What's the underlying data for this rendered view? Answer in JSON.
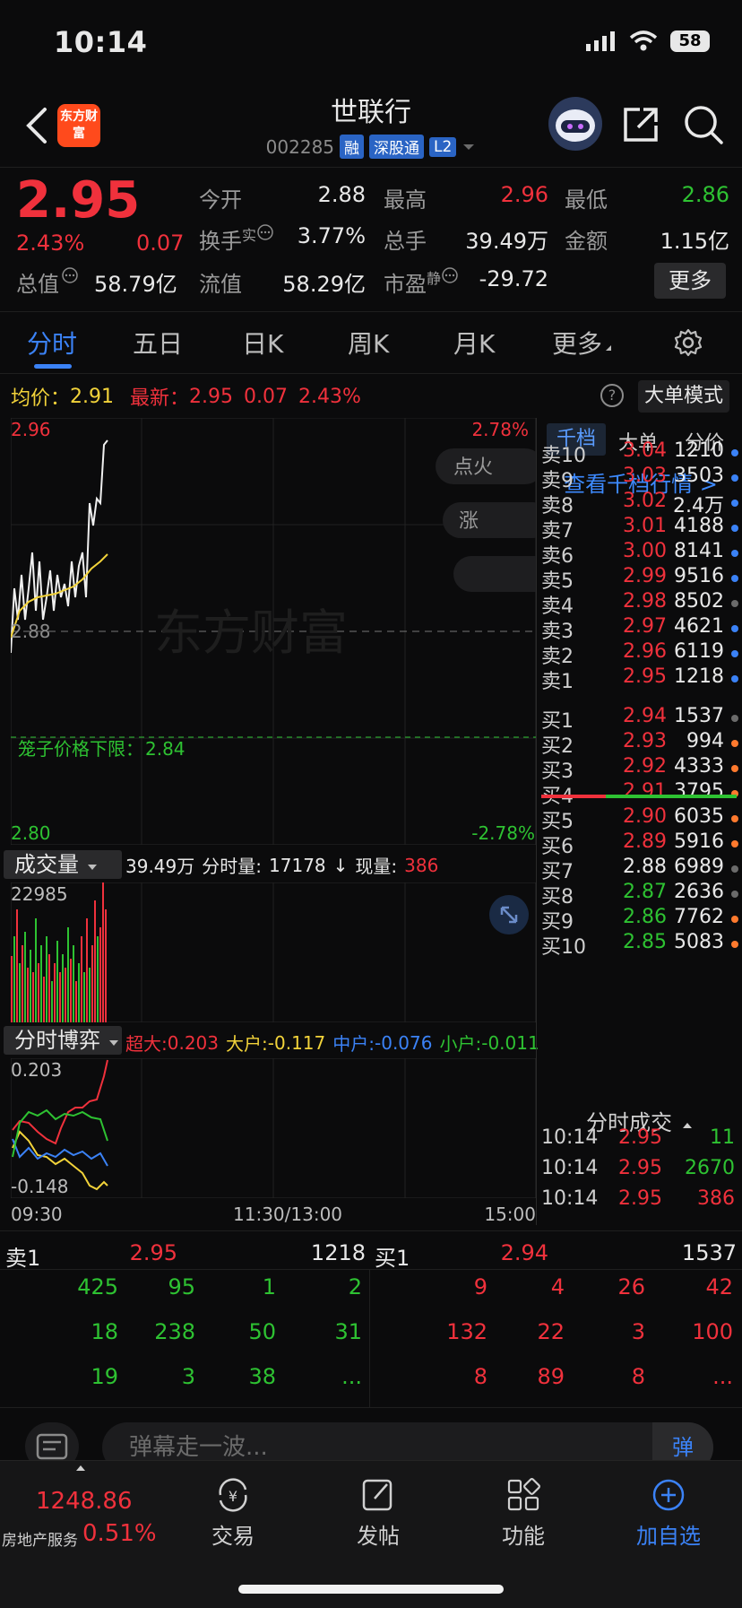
{
  "status_bar": {
    "time": "10:14",
    "battery": "58"
  },
  "header": {
    "logo_text": "东方财富",
    "title": "世联行",
    "code": "002285",
    "tags": [
      "融",
      "深股通",
      "L2"
    ]
  },
  "quote": {
    "price": "2.95",
    "change_pct": "2.43%",
    "change": "0.07",
    "total_mv_label": "总值",
    "total_mv": "58.79亿",
    "open_label": "今开",
    "open": "2.88",
    "high_label": "最高",
    "high": "2.96",
    "low_label": "最低",
    "low": "2.86",
    "turnover_label": "换手",
    "turnover_sup": "实",
    "turnover": "3.77%",
    "volume_label": "总手",
    "volume": "39.49万",
    "amount_label": "金额",
    "amount": "1.15亿",
    "float_mv_label": "流值",
    "float_mv": "58.29亿",
    "pe_label": "市盈",
    "pe_sup": "静",
    "pe": "-29.72",
    "more_label": "更多"
  },
  "tabs": [
    "分时",
    "五日",
    "日K",
    "周K",
    "月K",
    "更多"
  ],
  "info_line": {
    "avg_label": "均价：",
    "avg": "2.91",
    "latest_label": "最新：",
    "latest": "2.95",
    "latest_chg": "0.07",
    "latest_pct": "2.43%",
    "help": "?",
    "big_order_mode": "大单模式"
  },
  "price_chart": {
    "top_price": "2.96",
    "bottom_price": "2.80",
    "top_pct": "2.78%",
    "bottom_pct": "-2.78%",
    "ref_label": "2.88",
    "cage_label": "笼子价格下限：",
    "cage_value": "2.84",
    "watermark": "东方财富",
    "side_btn_1": "点火",
    "side_btn_2": "涨"
  },
  "volume": {
    "select": "成交量",
    "total": "39.49万",
    "minute_label": "分时量:",
    "minute_val": "17178",
    "arrow": "↓",
    "now_label": "现量:",
    "now_val": "386",
    "max": "22985"
  },
  "flow": {
    "select": "分时博弈",
    "super_label": "超大:",
    "super_val": "0.203",
    "big_label": "大户:",
    "big_val": "-0.117",
    "mid_label": "中户:",
    "mid_val": "-0.076",
    "small_label": "小户:",
    "small_val": "-0.011",
    "max": "0.203",
    "min": "-0.148"
  },
  "time_axis": [
    "09:30",
    "11:30/13:00",
    "15:00"
  ],
  "right_panel": {
    "tabs": [
      "千档",
      "大单",
      "分价"
    ],
    "view_depth": "查看千档行情 >",
    "asks": [
      {
        "label": "卖10",
        "price": "3.04",
        "vol": "1210",
        "dot": "#3b82f6"
      },
      {
        "label": "卖9",
        "price": "3.03",
        "vol": "3503",
        "dot": "#3b82f6"
      },
      {
        "label": "卖8",
        "price": "3.02",
        "vol": "2.4万",
        "dot": "#3b82f6"
      },
      {
        "label": "卖7",
        "price": "3.01",
        "vol": "4188",
        "dot": "#3b82f6"
      },
      {
        "label": "卖6",
        "price": "3.00",
        "vol": "8141",
        "dot": "#3b82f6"
      },
      {
        "label": "卖5",
        "price": "2.99",
        "vol": "9516",
        "dot": "#3b82f6"
      },
      {
        "label": "卖4",
        "price": "2.98",
        "vol": "8502",
        "dot": "#6b6b6b"
      },
      {
        "label": "卖3",
        "price": "2.97",
        "vol": "4621",
        "dot": "#3b82f6"
      },
      {
        "label": "卖2",
        "price": "2.96",
        "vol": "6119",
        "dot": "#3b82f6"
      },
      {
        "label": "卖1",
        "price": "2.95",
        "vol": "1218",
        "dot": "#3b82f6"
      }
    ],
    "bids": [
      {
        "label": "买1",
        "price": "2.94",
        "vol": "1537",
        "dot": "#6b6b6b",
        "color": "#f0313c"
      },
      {
        "label": "买2",
        "price": "2.93",
        "vol": "994",
        "dot": "#ff7a2e",
        "color": "#f0313c"
      },
      {
        "label": "买3",
        "price": "2.92",
        "vol": "4333",
        "dot": "#ff7a2e",
        "color": "#f0313c"
      },
      {
        "label": "买4",
        "price": "2.91",
        "vol": "3795",
        "dot": "#ff7a2e",
        "color": "#f0313c"
      },
      {
        "label": "买5",
        "price": "2.90",
        "vol": "6035",
        "dot": "#ff7a2e",
        "color": "#f0313c"
      },
      {
        "label": "买6",
        "price": "2.89",
        "vol": "5916",
        "dot": "#ff7a2e",
        "color": "#f0313c"
      },
      {
        "label": "买7",
        "price": "2.88",
        "vol": "6989",
        "dot": "#6b6b6b",
        "color": "#e8e8e8"
      },
      {
        "label": "买8",
        "price": "2.87",
        "vol": "2636",
        "dot": "#6b6b6b",
        "color": "#2ec232"
      },
      {
        "label": "买9",
        "price": "2.86",
        "vol": "7762",
        "dot": "#ff7a2e",
        "color": "#2ec232"
      },
      {
        "label": "买10",
        "price": "2.85",
        "vol": "5083",
        "dot": "#ff7a2e",
        "color": "#2ec232"
      }
    ],
    "trades_title": "分时成交",
    "trades": [
      {
        "time": "10:14",
        "price": "2.95",
        "vol": "11",
        "color": "#2ec232"
      },
      {
        "time": "10:14",
        "price": "2.95",
        "vol": "2670",
        "color": "#2ec232"
      },
      {
        "time": "10:14",
        "price": "2.95",
        "vol": "386",
        "color": "#f0313c"
      }
    ]
  },
  "level1": {
    "sell_label": "卖1",
    "sell_price": "2.95",
    "sell_vol": "1218",
    "buy_label": "买1",
    "buy_price": "2.94",
    "buy_vol": "1537",
    "sell_queue": [
      [
        "425",
        "95",
        "1",
        "2"
      ],
      [
        "18",
        "238",
        "50",
        "31"
      ],
      [
        "19",
        "3",
        "38",
        "..."
      ]
    ],
    "buy_queue": [
      [
        "9",
        "4",
        "26",
        "42"
      ],
      [
        "132",
        "22",
        "3",
        "100"
      ],
      [
        "8",
        "89",
        "8",
        "..."
      ]
    ]
  },
  "danmu": {
    "placeholder": "弹幕走一波...",
    "button": "弹"
  },
  "bottom_nav": {
    "index_value": "1248.86",
    "index_name": "房地产服务",
    "index_pct": "0.51%",
    "items": [
      "交易",
      "发帖",
      "功能",
      "加自选"
    ]
  },
  "colors": {
    "up": "#f0313c",
    "down": "#2ec232",
    "accent": "#3b82f6",
    "avg_line": "#f2d33a"
  }
}
